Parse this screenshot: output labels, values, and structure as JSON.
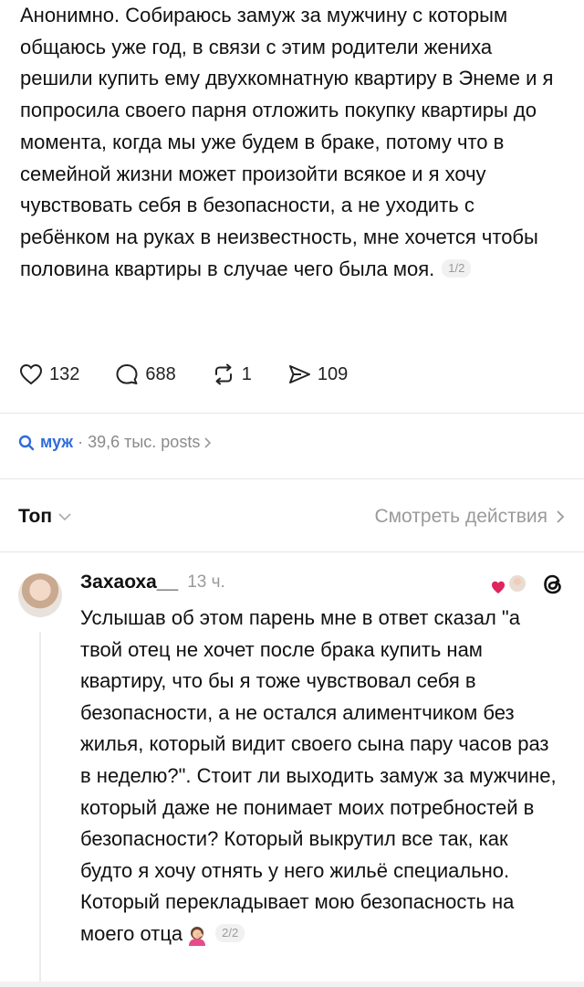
{
  "post": {
    "text": "Анонимно. Собираюсь замуж за мужчину с которым общаюсь уже год, в связи с этим родители жениха решили купить ему двухкомнатную квартиру в Энеме и я попросила своего парня отложить покупку квартиры до момента, когда мы уже будем в браке, потому что в семейной жизни может произойти всякое и я хочу чувствовать себя в безопасности, а не уходить с ребёнком на руках в неизвестность, мне хочется чтобы половина квартиры в случае чего была моя.",
    "page_indicator": "1/2",
    "likes": "132",
    "replies": "688",
    "reposts": "1",
    "shares": "109"
  },
  "search_chip": {
    "query": "муж",
    "separator": "·",
    "count": "39,6 тыс. posts"
  },
  "sort_bar": {
    "sort_label": "Топ",
    "view_activity_label": "Смотреть действия"
  },
  "comment": {
    "username": "Захаоха__",
    "time": "13 ч.",
    "text": "Услышав об этом парень мне в ответ сказал \"а твой отец не хочет после брака купить нам квартиру, что бы я тоже чувствовал себя в безопасности, а не остался алиментчиком без жилья, который видит своего сына пару часов раз в неделю?\". Стоит ли выходить замуж за мужчине, который даже не понимает моих потребностей в безопасности? Который выкрутил все так, как будто я хочу отнять у него жильё специально. Который перекладывает мою безопасность на моего отца",
    "page_indicator": "2/2"
  },
  "icons": {
    "like": "heart-outline-icon",
    "reply": "comment-bubble-icon",
    "repost": "repost-arrows-icon",
    "share": "send-icon",
    "search": "search-icon",
    "sort": "chevron-down-icon",
    "view": "chevron-right-icon",
    "threads": "threads-logo-icon",
    "liked_by_author": "red-heart-icon",
    "emoji": "woman-facepalming-emoji"
  },
  "colors": {
    "search_query": "#2f6dd8",
    "muted": "#9a9a9a",
    "liked_heart": "#e0245e"
  }
}
